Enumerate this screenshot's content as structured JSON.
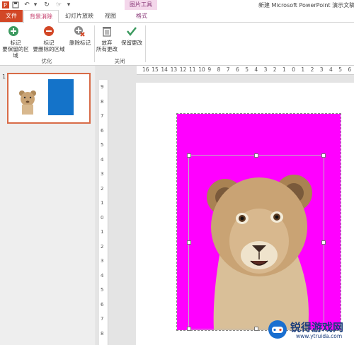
{
  "quick_access": {
    "save_icon": "save-icon",
    "undo_icon": "undo-icon",
    "redo_icon": "redo-icon",
    "more_icon": "customize-icon"
  },
  "context_tab_label": "图片工具",
  "window_title": "新建 Microsoft PowerPoint 演示文稿",
  "tabs": {
    "file": "文件",
    "background_removal": "背景消除",
    "slideshow": "幻灯片放映",
    "view": "视图",
    "format": "格式"
  },
  "ribbon": {
    "mark_keep": "标记\n要保留的区域",
    "mark_remove": "标记\n要删除的区域",
    "delete_mark": "删除标记",
    "group_refine": "优化",
    "discard_all": "放弃\n所有更改",
    "keep_changes": "保留更改",
    "group_close": "关闭"
  },
  "slide_number": "1",
  "ruler": {
    "horizontal": [
      "16",
      "15",
      "14",
      "13",
      "12",
      "11",
      "10",
      "9",
      "8",
      "7",
      "6",
      "5",
      "4",
      "3",
      "2",
      "1",
      "0",
      "1",
      "2",
      "3",
      "4",
      "5",
      "6"
    ],
    "vertical": [
      "9",
      "8",
      "7",
      "6",
      "5",
      "4",
      "3",
      "2",
      "1",
      "0",
      "1",
      "2",
      "3",
      "4",
      "5",
      "6",
      "7",
      "8"
    ]
  },
  "colors": {
    "accent": "#d24726",
    "context_tab": "#f4d7eb",
    "removal_fill": "#ff00ff",
    "thumb_rect": "#1473c9"
  },
  "watermark": {
    "text": "锐得游戏网",
    "url": "www.ytruida.com"
  }
}
